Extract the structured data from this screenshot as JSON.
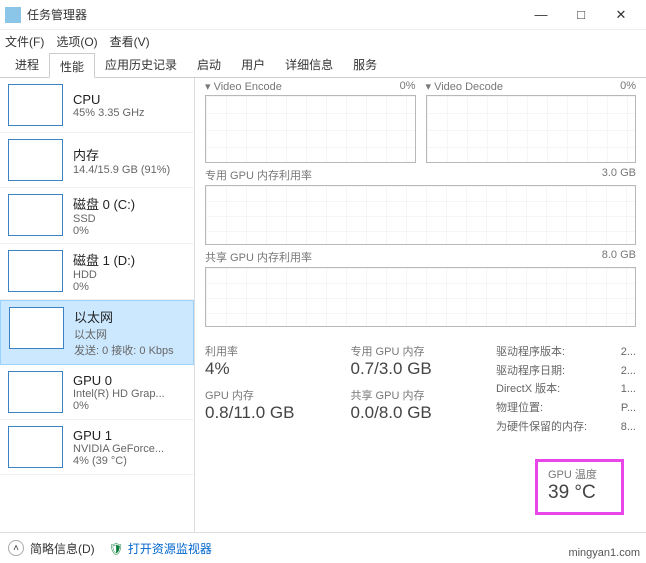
{
  "titlebar": {
    "title": "任务管理器",
    "min": "—",
    "max": "□",
    "close": "✕"
  },
  "menubar": {
    "file": "文件(F)",
    "options": "选项(O)",
    "view": "查看(V)"
  },
  "tabs": [
    "进程",
    "性能",
    "应用历史记录",
    "启动",
    "用户",
    "详细信息",
    "服务"
  ],
  "sidebar": [
    {
      "name": "CPU",
      "sub": "45%  3.35 GHz",
      "sub2": ""
    },
    {
      "name": "内存",
      "sub": "14.4/15.9 GB (91%)",
      "sub2": ""
    },
    {
      "name": "磁盘 0 (C:)",
      "sub": "SSD",
      "sub2": "0%"
    },
    {
      "name": "磁盘 1 (D:)",
      "sub": "HDD",
      "sub2": "0%"
    },
    {
      "name": "以太网",
      "sub": "以太网",
      "sub2": "发送: 0  接收: 0 Kbps"
    },
    {
      "name": "GPU 0",
      "sub": "Intel(R) HD Grap...",
      "sub2": "0%"
    },
    {
      "name": "GPU 1",
      "sub": "NVIDIA GeForce...",
      "sub2": "4% (39 °C)"
    }
  ],
  "detail": {
    "mini": [
      {
        "name": "Video Encode",
        "val": "0%"
      },
      {
        "name": "Video Decode",
        "val": "0%"
      }
    ],
    "mem1": {
      "label": "专用 GPU 内存利用率",
      "max": "3.0 GB"
    },
    "mem2": {
      "label": "共享 GPU 内存利用率",
      "max": "8.0 GB"
    },
    "stats": {
      "util": {
        "label": "利用率",
        "value": "4%"
      },
      "dedmem": {
        "label": "专用 GPU 内存",
        "value": "0.7/3.0 GB"
      },
      "gpumem": {
        "label": "GPU 内存",
        "value": "0.8/11.0 GB"
      },
      "shmem": {
        "label": "共享 GPU 内存",
        "value": "0.0/8.0 GB"
      },
      "temp": {
        "label": "GPU 温度",
        "value": "39 °C"
      }
    },
    "props": {
      "driver_ver": {
        "label": "驱动程序版本:",
        "value": "2..."
      },
      "driver_date": {
        "label": "驱动程序日期:",
        "value": "2..."
      },
      "directx": {
        "label": "DirectX 版本:",
        "value": "1..."
      },
      "phys": {
        "label": "物理位置:",
        "value": "P..."
      },
      "reserved": {
        "label": "为硬件保留的内存:",
        "value": "8..."
      }
    }
  },
  "footer": {
    "brief": "简略信息(D)",
    "link": "打开资源监视器"
  },
  "watermark": "mingyan1.com"
}
